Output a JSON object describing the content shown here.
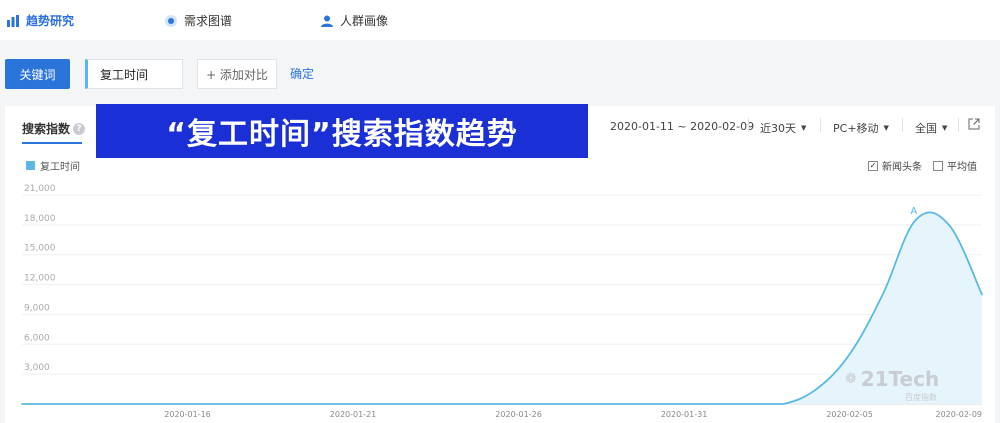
{
  "topnav": {
    "items": [
      {
        "label": "趋势研究",
        "icon": "chart-icon",
        "active": true
      },
      {
        "label": "需求图谱",
        "icon": "radar-icon",
        "active": false
      },
      {
        "label": "人群画像",
        "icon": "person-icon",
        "active": false
      }
    ]
  },
  "query": {
    "keyword_button": "关键词",
    "keyword_value": "复工时间",
    "add_compare": "+ 添加对比",
    "confirm": "确定"
  },
  "panel": {
    "title": "搜索指数",
    "help": "?",
    "banner": "“复工时间”搜索指数趋势",
    "date_range": "2020-01-11 ~ 2020-02-09",
    "period": "近30天",
    "device": "PC+移动",
    "region": "全国",
    "legend": "复工时间",
    "option_news": "新闻头条",
    "option_news_check": "✓",
    "option_avg": "平均值",
    "watermark": "21Tech",
    "watermark_sub": "百度指数"
  },
  "colors": {
    "accent": "#2b74d9",
    "series": "#5bb8e6",
    "banner": "#1b2fd6"
  },
  "chart_data": {
    "type": "area",
    "series": [
      {
        "name": "复工时间",
        "x": [
          "2020-01-11",
          "2020-01-12",
          "2020-01-13",
          "2020-01-14",
          "2020-01-15",
          "2020-01-16",
          "2020-01-17",
          "2020-01-18",
          "2020-01-19",
          "2020-01-20",
          "2020-01-21",
          "2020-01-22",
          "2020-01-23",
          "2020-01-24",
          "2020-01-25",
          "2020-01-26",
          "2020-01-27",
          "2020-01-28",
          "2020-01-29",
          "2020-01-30",
          "2020-01-31",
          "2020-02-01",
          "2020-02-02",
          "2020-02-03",
          "2020-02-04",
          "2020-02-05",
          "2020-02-06",
          "2020-02-07",
          "2020-02-08",
          "2020-02-09"
        ],
        "values": [
          0,
          0,
          0,
          0,
          0,
          0,
          0,
          0,
          0,
          0,
          0,
          0,
          0,
          0,
          0,
          0,
          0,
          0,
          0,
          0,
          0,
          0,
          0,
          0,
          1500,
          5000,
          11000,
          18500,
          18000,
          11000
        ]
      }
    ],
    "yticks": [
      "21,000",
      "18,000",
      "15,000",
      "12,000",
      "9,000",
      "6,000",
      "3,000"
    ],
    "ytick_values": [
      21000,
      18000,
      15000,
      12000,
      9000,
      6000,
      3000
    ],
    "xticks": [
      "2020-01-16",
      "2020-01-21",
      "2020-01-26",
      "2020-01-31",
      "2020-02-05",
      "2020-02-09"
    ],
    "ylim": [
      0,
      21000
    ],
    "annotation": "A",
    "annotation_index": 27,
    "grid": true
  }
}
